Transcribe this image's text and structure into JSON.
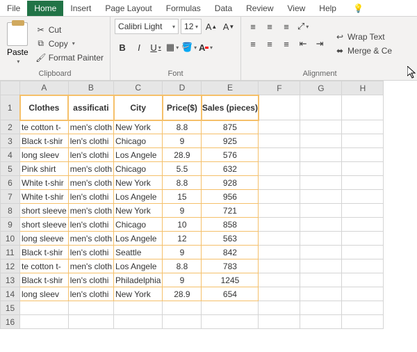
{
  "tabs": {
    "file": "File",
    "home": "Home",
    "insert": "Insert",
    "pagelayout": "Page Layout",
    "formulas": "Formulas",
    "data": "Data",
    "review": "Review",
    "view": "View",
    "help": "Help"
  },
  "ribbon": {
    "paste": "Paste",
    "cut": "Cut",
    "copy": "Copy",
    "formatpainter": "Format Painter",
    "clipboard": "Clipboard",
    "font_group": "Font",
    "alignment": "Alignment",
    "fontname": "Calibri Light",
    "fontsize": "12",
    "wraptext": "Wrap Text",
    "mergecenter": "Merge & Ce"
  },
  "columns": [
    "A",
    "B",
    "C",
    "D",
    "E",
    "F",
    "G",
    "H"
  ],
  "headers": {
    "a": "Clothes",
    "b": "assificati",
    "c": "City",
    "d": "Price($)",
    "e": "Sales (pieces)"
  },
  "rows": [
    {
      "n": 2,
      "a": "te cotton t-",
      "b": "men's cloth",
      "c": "New York",
      "d": "8.8",
      "e": "875"
    },
    {
      "n": 3,
      "a": "Black t-shir",
      "b": "len's clothi",
      "c": "Chicago",
      "d": "9",
      "e": "925"
    },
    {
      "n": 4,
      "a": " long sleev",
      "b": "len's clothi",
      "c": "Los Angele",
      "d": "28.9",
      "e": "576"
    },
    {
      "n": 5,
      "a": "Pink shirt",
      "b": "men's cloth",
      "c": "Chicago",
      "d": "5.5",
      "e": "632"
    },
    {
      "n": 6,
      "a": "White t-shir",
      "b": "men's cloth",
      "c": "New York",
      "d": "8.8",
      "e": "928"
    },
    {
      "n": 7,
      "a": "White t-shir",
      "b": "len's clothi",
      "c": "Los Angele",
      "d": "15",
      "e": "956"
    },
    {
      "n": 8,
      "a": "short sleeve",
      "b": "men's cloth",
      "c": "New York",
      "d": "9",
      "e": "721"
    },
    {
      "n": 9,
      "a": "short sleeve",
      "b": "len's clothi",
      "c": "Chicago",
      "d": "10",
      "e": "858"
    },
    {
      "n": 10,
      "a": "long sleeve",
      "b": "men's cloth",
      "c": "Los Angele",
      "d": "12",
      "e": "563"
    },
    {
      "n": 11,
      "a": "Black t-shir",
      "b": "len's clothi",
      "c": "Seattle",
      "d": "9",
      "e": "842"
    },
    {
      "n": 12,
      "a": "te cotton t-",
      "b": "men's cloth",
      "c": "Los Angele",
      "d": "8.8",
      "e": "783"
    },
    {
      "n": 13,
      "a": "Black t-shir",
      "b": "len's clothi",
      "c": "Philadelphia",
      "d": "9",
      "e": "1245"
    },
    {
      "n": 14,
      "a": " long sleev",
      "b": "len's clothi",
      "c": "New York",
      "d": "28.9",
      "e": "654"
    }
  ],
  "emptyRows": [
    15,
    16
  ]
}
